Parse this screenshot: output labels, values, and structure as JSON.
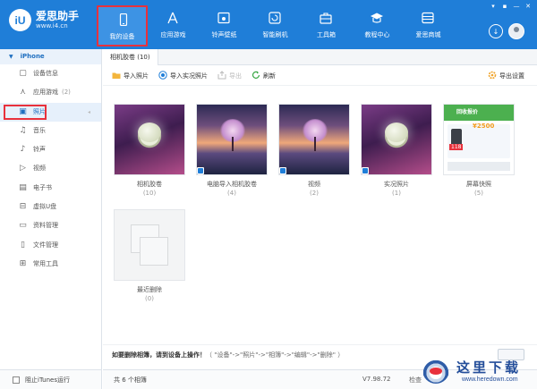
{
  "app": {
    "logo_mark": "iU",
    "name": "爱思助手",
    "url": "www.i4.cn"
  },
  "nav": [
    {
      "label": "我的设备",
      "icon": "phone-icon",
      "active": true
    },
    {
      "label": "应用游戏",
      "icon": "apps-icon",
      "active": false
    },
    {
      "label": "铃声壁纸",
      "icon": "ringtone-wallpaper-icon",
      "active": false
    },
    {
      "label": "智能刷机",
      "icon": "flash-icon",
      "active": false
    },
    {
      "label": "工具箱",
      "icon": "toolbox-icon",
      "active": false
    },
    {
      "label": "教程中心",
      "icon": "tutorial-icon",
      "active": false
    },
    {
      "label": "爱思商城",
      "icon": "store-icon",
      "active": false
    }
  ],
  "window_controls": [
    "▾",
    "▪",
    "—",
    "✕"
  ],
  "top_right": {
    "download_icon": "download-icon",
    "avatar": "user-avatar"
  },
  "sidebar": {
    "device": "iPhone",
    "items": [
      {
        "label": "设备信息",
        "count": "",
        "icon": "device-info-icon"
      },
      {
        "label": "应用游戏",
        "count": "(2)",
        "icon": "apps-icon"
      },
      {
        "label": "照片",
        "count": "",
        "icon": "photo-icon",
        "active": true
      },
      {
        "label": "音乐",
        "count": "",
        "icon": "music-icon"
      },
      {
        "label": "铃声",
        "count": "",
        "icon": "bell-icon"
      },
      {
        "label": "视频",
        "count": "",
        "icon": "video-icon"
      },
      {
        "label": "电子书",
        "count": "",
        "icon": "ebook-icon"
      },
      {
        "label": "虚拟U盘",
        "count": "",
        "icon": "usb-icon"
      },
      {
        "label": "资料管理",
        "count": "",
        "icon": "folder-icon"
      },
      {
        "label": "文件管理",
        "count": "",
        "icon": "file-icon"
      },
      {
        "label": "常用工具",
        "count": "",
        "icon": "tools-icon"
      }
    ],
    "footer_checkbox": "阻止iTunes运行"
  },
  "tab": {
    "label": "相机胶卷 (10)"
  },
  "toolbar": {
    "import_photos": "导入照片",
    "import_live": "导入实况照片",
    "export": "导出",
    "refresh": "刷新",
    "export_settings": "导出设置"
  },
  "albums": [
    {
      "name": "相机胶卷",
      "count": "(10)",
      "thumb": "moon"
    },
    {
      "name": "电脑导入相机胶卷",
      "count": "(4)",
      "thumb": "tree"
    },
    {
      "name": "视频",
      "count": "(2)",
      "thumb": "tree"
    },
    {
      "name": "实况照片",
      "count": "(1)",
      "thumb": "moon"
    },
    {
      "name": "屏幕快照",
      "count": "(5)",
      "thumb": "screenshot"
    },
    {
      "name": "最近删除",
      "count": "(0)",
      "thumb": "blank"
    }
  ],
  "screenshot_thumb": {
    "banner": "回收报价",
    "price": "¥2500",
    "tag": "118"
  },
  "hint": {
    "bold": "如要删除相簿，请到设备上操作！",
    "path": "（ \"设备\"->\"照片\"->\"相簿\"->\"编辑\"->\"删除\" ）"
  },
  "status": {
    "count": "共 6 个相簿",
    "version": "V7.98.72",
    "update": "检查"
  },
  "watermark": {
    "title": "这里下载",
    "url": "www.heredown.com"
  },
  "colors": {
    "accent": "#1f7ed8",
    "highlight": "#e8313c"
  }
}
